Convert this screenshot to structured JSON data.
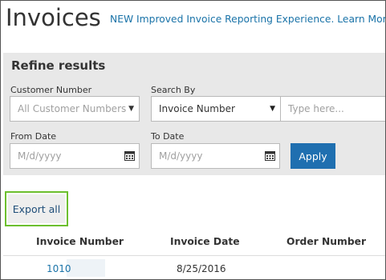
{
  "page": {
    "title": "Invoices",
    "banner_link": "NEW Improved Invoice Reporting Experience. Learn More"
  },
  "refine": {
    "title": "Refine results",
    "customer_number": {
      "label": "Customer Number",
      "placeholder": "All Customer Numbers"
    },
    "search_by": {
      "label": "Search By",
      "selected": "Invoice Number",
      "search_placeholder": "Type here..."
    },
    "from_date": {
      "label": "From Date",
      "placeholder": "M/d/yyyy"
    },
    "to_date": {
      "label": "To Date",
      "placeholder": "M/d/yyyy"
    },
    "apply_label": "Apply"
  },
  "actions": {
    "export_label": "Export all",
    "export_highlight_color": "#6cbf2e"
  },
  "table": {
    "columns": [
      "Invoice Number",
      "Invoice Date",
      "Order Number"
    ],
    "rows": [
      {
        "invoice_number": "1010",
        "invoice_date": "8/25/2016",
        "order_number": ""
      }
    ]
  },
  "colors": {
    "link": "#1a73a8",
    "apply_button": "#1f6fb0",
    "panel_bg": "#e8e8e8"
  },
  "icons": {
    "date_picker": "calendar-icon",
    "select_caret": "caret-down-icon"
  }
}
